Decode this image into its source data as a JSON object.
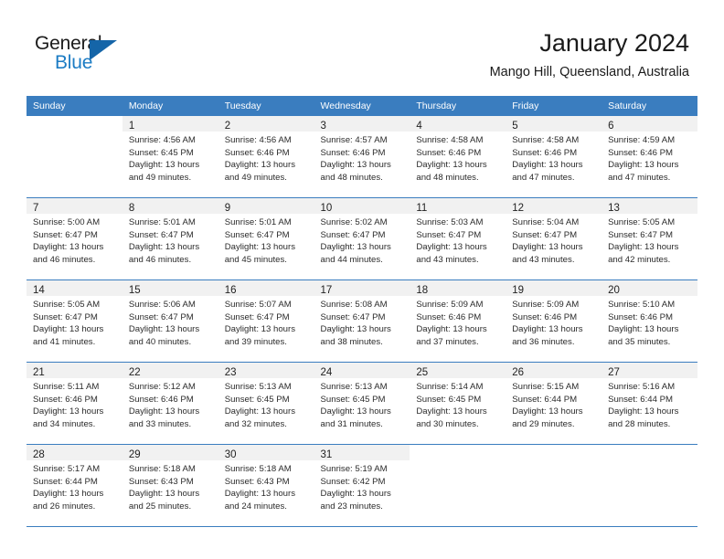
{
  "logo": {
    "word1": "General",
    "word2": "Blue",
    "triangle_color": "#1565a8",
    "blue_color": "#1c7cc4"
  },
  "header": {
    "title": "January 2024",
    "location": "Mango Hill, Queensland, Australia"
  },
  "theme": {
    "header_blue": "#3a7dbf",
    "row_divider": "#3a7dbf",
    "daynum_band": "#f1f1f1",
    "text": "#2b2b2b"
  },
  "weekday_headers": [
    "Sunday",
    "Monday",
    "Tuesday",
    "Wednesday",
    "Thursday",
    "Friday",
    "Saturday"
  ],
  "labels": {
    "sunrise_prefix": "Sunrise:",
    "sunset_prefix": "Sunset:",
    "daylight_prefix": "Daylight:"
  },
  "weeks": [
    [
      {
        "day": "",
        "l1": "",
        "l2": "",
        "l3": "",
        "l4": ""
      },
      {
        "day": "1",
        "l1": "Sunrise: 4:56 AM",
        "l2": "Sunset: 6:45 PM",
        "l3": "Daylight: 13 hours",
        "l4": "and 49 minutes."
      },
      {
        "day": "2",
        "l1": "Sunrise: 4:56 AM",
        "l2": "Sunset: 6:46 PM",
        "l3": "Daylight: 13 hours",
        "l4": "and 49 minutes."
      },
      {
        "day": "3",
        "l1": "Sunrise: 4:57 AM",
        "l2": "Sunset: 6:46 PM",
        "l3": "Daylight: 13 hours",
        "l4": "and 48 minutes."
      },
      {
        "day": "4",
        "l1": "Sunrise: 4:58 AM",
        "l2": "Sunset: 6:46 PM",
        "l3": "Daylight: 13 hours",
        "l4": "and 48 minutes."
      },
      {
        "day": "5",
        "l1": "Sunrise: 4:58 AM",
        "l2": "Sunset: 6:46 PM",
        "l3": "Daylight: 13 hours",
        "l4": "and 47 minutes."
      },
      {
        "day": "6",
        "l1": "Sunrise: 4:59 AM",
        "l2": "Sunset: 6:46 PM",
        "l3": "Daylight: 13 hours",
        "l4": "and 47 minutes."
      }
    ],
    [
      {
        "day": "7",
        "l1": "Sunrise: 5:00 AM",
        "l2": "Sunset: 6:47 PM",
        "l3": "Daylight: 13 hours",
        "l4": "and 46 minutes."
      },
      {
        "day": "8",
        "l1": "Sunrise: 5:01 AM",
        "l2": "Sunset: 6:47 PM",
        "l3": "Daylight: 13 hours",
        "l4": "and 46 minutes."
      },
      {
        "day": "9",
        "l1": "Sunrise: 5:01 AM",
        "l2": "Sunset: 6:47 PM",
        "l3": "Daylight: 13 hours",
        "l4": "and 45 minutes."
      },
      {
        "day": "10",
        "l1": "Sunrise: 5:02 AM",
        "l2": "Sunset: 6:47 PM",
        "l3": "Daylight: 13 hours",
        "l4": "and 44 minutes."
      },
      {
        "day": "11",
        "l1": "Sunrise: 5:03 AM",
        "l2": "Sunset: 6:47 PM",
        "l3": "Daylight: 13 hours",
        "l4": "and 43 minutes."
      },
      {
        "day": "12",
        "l1": "Sunrise: 5:04 AM",
        "l2": "Sunset: 6:47 PM",
        "l3": "Daylight: 13 hours",
        "l4": "and 43 minutes."
      },
      {
        "day": "13",
        "l1": "Sunrise: 5:05 AM",
        "l2": "Sunset: 6:47 PM",
        "l3": "Daylight: 13 hours",
        "l4": "and 42 minutes."
      }
    ],
    [
      {
        "day": "14",
        "l1": "Sunrise: 5:05 AM",
        "l2": "Sunset: 6:47 PM",
        "l3": "Daylight: 13 hours",
        "l4": "and 41 minutes."
      },
      {
        "day": "15",
        "l1": "Sunrise: 5:06 AM",
        "l2": "Sunset: 6:47 PM",
        "l3": "Daylight: 13 hours",
        "l4": "and 40 minutes."
      },
      {
        "day": "16",
        "l1": "Sunrise: 5:07 AM",
        "l2": "Sunset: 6:47 PM",
        "l3": "Daylight: 13 hours",
        "l4": "and 39 minutes."
      },
      {
        "day": "17",
        "l1": "Sunrise: 5:08 AM",
        "l2": "Sunset: 6:47 PM",
        "l3": "Daylight: 13 hours",
        "l4": "and 38 minutes."
      },
      {
        "day": "18",
        "l1": "Sunrise: 5:09 AM",
        "l2": "Sunset: 6:46 PM",
        "l3": "Daylight: 13 hours",
        "l4": "and 37 minutes."
      },
      {
        "day": "19",
        "l1": "Sunrise: 5:09 AM",
        "l2": "Sunset: 6:46 PM",
        "l3": "Daylight: 13 hours",
        "l4": "and 36 minutes."
      },
      {
        "day": "20",
        "l1": "Sunrise: 5:10 AM",
        "l2": "Sunset: 6:46 PM",
        "l3": "Daylight: 13 hours",
        "l4": "and 35 minutes."
      }
    ],
    [
      {
        "day": "21",
        "l1": "Sunrise: 5:11 AM",
        "l2": "Sunset: 6:46 PM",
        "l3": "Daylight: 13 hours",
        "l4": "and 34 minutes."
      },
      {
        "day": "22",
        "l1": "Sunrise: 5:12 AM",
        "l2": "Sunset: 6:46 PM",
        "l3": "Daylight: 13 hours",
        "l4": "and 33 minutes."
      },
      {
        "day": "23",
        "l1": "Sunrise: 5:13 AM",
        "l2": "Sunset: 6:45 PM",
        "l3": "Daylight: 13 hours",
        "l4": "and 32 minutes."
      },
      {
        "day": "24",
        "l1": "Sunrise: 5:13 AM",
        "l2": "Sunset: 6:45 PM",
        "l3": "Daylight: 13 hours",
        "l4": "and 31 minutes."
      },
      {
        "day": "25",
        "l1": "Sunrise: 5:14 AM",
        "l2": "Sunset: 6:45 PM",
        "l3": "Daylight: 13 hours",
        "l4": "and 30 minutes."
      },
      {
        "day": "26",
        "l1": "Sunrise: 5:15 AM",
        "l2": "Sunset: 6:44 PM",
        "l3": "Daylight: 13 hours",
        "l4": "and 29 minutes."
      },
      {
        "day": "27",
        "l1": "Sunrise: 5:16 AM",
        "l2": "Sunset: 6:44 PM",
        "l3": "Daylight: 13 hours",
        "l4": "and 28 minutes."
      }
    ],
    [
      {
        "day": "28",
        "l1": "Sunrise: 5:17 AM",
        "l2": "Sunset: 6:44 PM",
        "l3": "Daylight: 13 hours",
        "l4": "and 26 minutes."
      },
      {
        "day": "29",
        "l1": "Sunrise: 5:18 AM",
        "l2": "Sunset: 6:43 PM",
        "l3": "Daylight: 13 hours",
        "l4": "and 25 minutes."
      },
      {
        "day": "30",
        "l1": "Sunrise: 5:18 AM",
        "l2": "Sunset: 6:43 PM",
        "l3": "Daylight: 13 hours",
        "l4": "and 24 minutes."
      },
      {
        "day": "31",
        "l1": "Sunrise: 5:19 AM",
        "l2": "Sunset: 6:42 PM",
        "l3": "Daylight: 13 hours",
        "l4": "and 23 minutes."
      },
      {
        "day": "",
        "l1": "",
        "l2": "",
        "l3": "",
        "l4": ""
      },
      {
        "day": "",
        "l1": "",
        "l2": "",
        "l3": "",
        "l4": ""
      },
      {
        "day": "",
        "l1": "",
        "l2": "",
        "l3": "",
        "l4": ""
      }
    ]
  ]
}
